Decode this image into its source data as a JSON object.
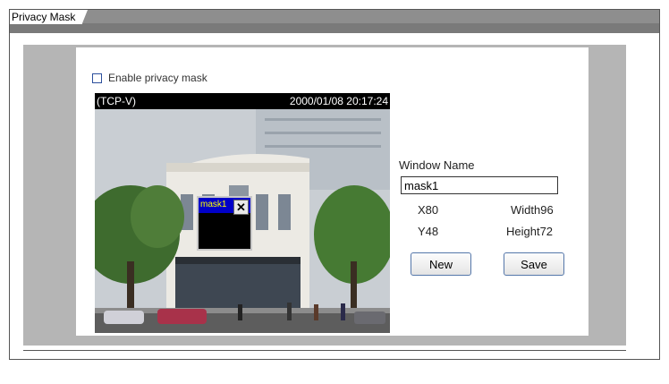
{
  "section": {
    "title": "Privacy Mask"
  },
  "enable": {
    "label": "Enable privacy mask",
    "checked": false
  },
  "video": {
    "stream_label": "(TCP-V)",
    "timestamp": "2000/01/08 20:17:24"
  },
  "mask": {
    "label": "mask1",
    "close_symbol": "✕"
  },
  "form": {
    "window_name_label": "Window Name",
    "window_name_value": "mask1",
    "x_label": "X80",
    "y_label": "Y48",
    "width_label": "Width96",
    "height_label": "Height72",
    "new_button": "New",
    "save_button": "Save"
  },
  "colors": {
    "header_bar": "#8e8e8e",
    "gray_area": "#b5b5b5",
    "mask_title": "#0000c8",
    "mask_text": "#ffff00"
  }
}
